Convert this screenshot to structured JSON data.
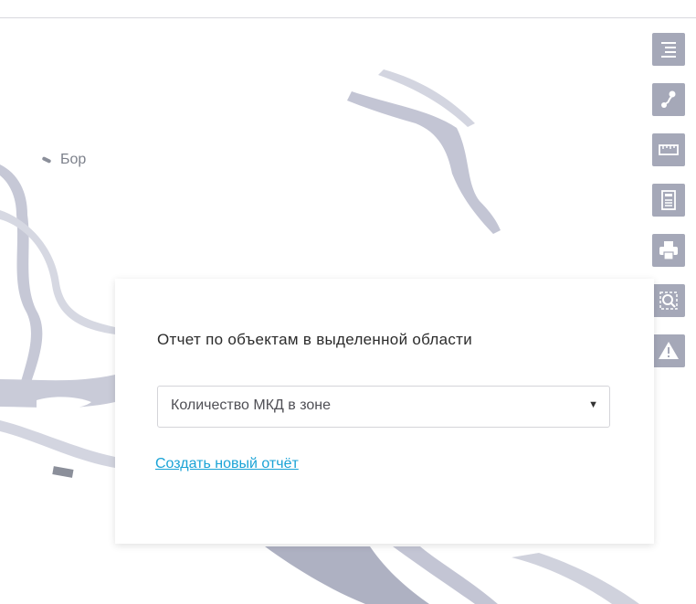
{
  "map": {
    "place_label": "Бор"
  },
  "toolbar": {
    "buttons": [
      {
        "icon": "layers-list-icon"
      },
      {
        "icon": "route-icon"
      },
      {
        "icon": "ruler-icon"
      },
      {
        "icon": "report-icon"
      },
      {
        "icon": "printer-icon"
      },
      {
        "icon": "area-select-icon"
      },
      {
        "icon": "warning-icon"
      }
    ],
    "button_color": "#a5a8b8"
  },
  "report_panel": {
    "title": "Отчет по объектам в выделенной области",
    "select": {
      "value": "Количество МКД в зоне",
      "arrow": "▼"
    },
    "create_link": "Создать новый отчёт"
  },
  "colors": {
    "link": "#1aa3d6",
    "river": "#c8cad8",
    "map_bg": "#ffffff"
  }
}
